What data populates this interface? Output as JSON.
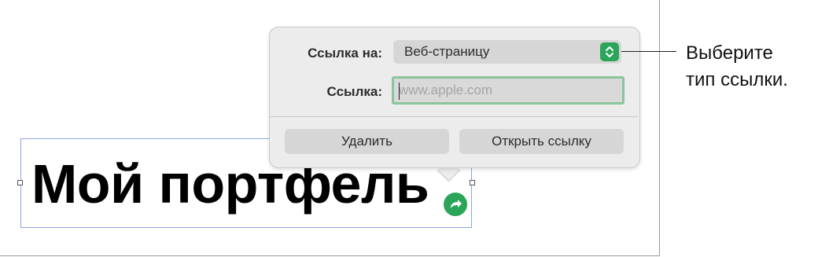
{
  "document": {
    "title_text": "Мой портфель"
  },
  "popover": {
    "link_to_label": "Ссылка на:",
    "link_to_value": "Веб-страницу",
    "link_label": "Ссылка:",
    "link_placeholder": "www.apple.com",
    "remove_button": "Удалить",
    "open_link_button": "Открыть ссылку"
  },
  "callout": {
    "line1": "Выберите",
    "line2": "тип ссылки."
  },
  "colors": {
    "accent_green": "#2aa55a",
    "selection_blue": "#8aa7e6",
    "input_focus": "#8bc49a"
  },
  "icons": {
    "stepper": "up-down-chevron-icon",
    "link_badge": "curved-arrow-icon"
  }
}
